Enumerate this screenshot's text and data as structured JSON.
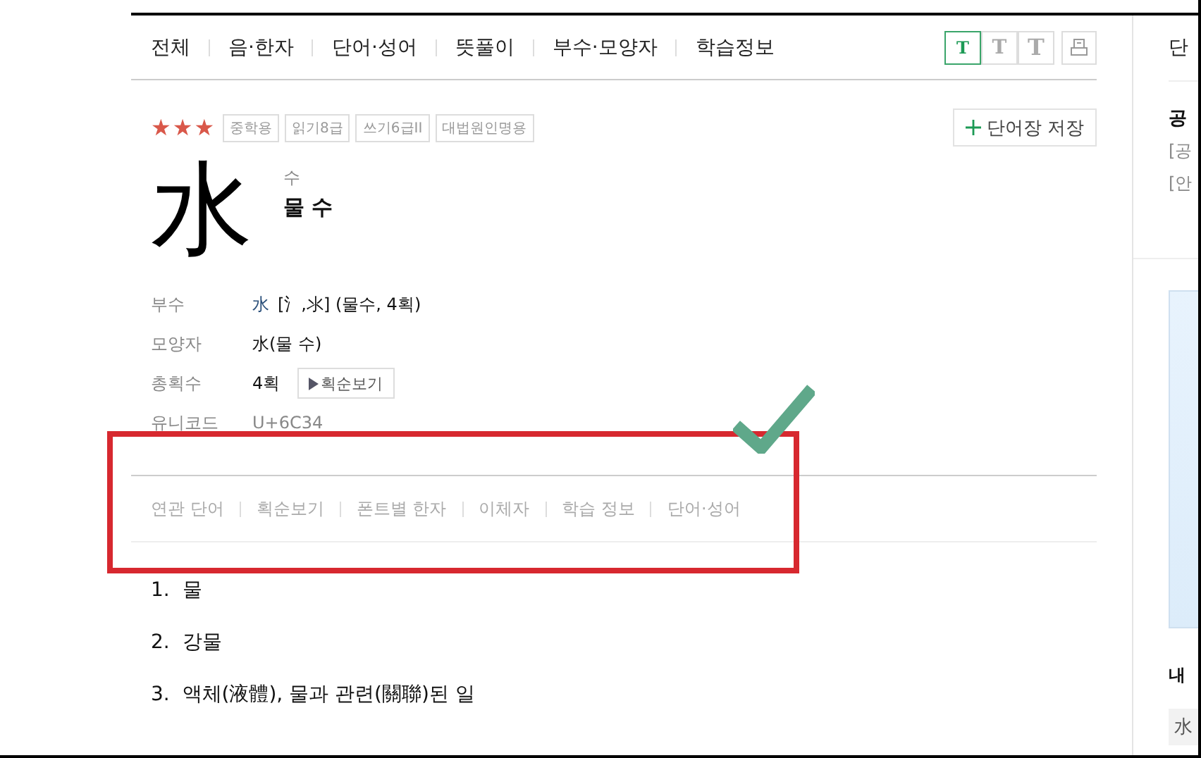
{
  "tabs": [
    {
      "label": "전체",
      "selected": false
    },
    {
      "label": "음·한자",
      "selected": false
    },
    {
      "label": "단어·성어",
      "selected": false
    },
    {
      "label": "뜻풀이",
      "selected": false
    },
    {
      "label": "부수·모양자",
      "selected": false
    },
    {
      "label": "학습정보",
      "selected": false
    }
  ],
  "font_sizes": [
    {
      "label": "T",
      "selected": true
    },
    {
      "label": "T",
      "selected": false
    },
    {
      "label": "T",
      "selected": false
    }
  ],
  "entry": {
    "stars": 3,
    "tags": [
      "중학용",
      "읽기8급",
      "쓰기6급II",
      "대법원인명용"
    ],
    "save_button": "단어장 저장",
    "character": "水",
    "reading": "수",
    "meaning": "물 수",
    "info": [
      {
        "label": "부수",
        "value": "水",
        "value_rest": "[氵,氺] (물수, 4획)"
      },
      {
        "label": "모양자",
        "value": "水(물 수)"
      },
      {
        "label": "총획수",
        "value": "4획",
        "button": "획순보기"
      },
      {
        "label": "유니코드",
        "value": "U+6C34"
      }
    ]
  },
  "subnav": [
    "연관 단어",
    "획순보기",
    "폰트별 한자",
    "이체자",
    "학습 정보",
    "단어·성어"
  ],
  "definitions": [
    "1.  물",
    "2.  강물",
    "3.  액체(液體), 물과 관련(關聯)된 일"
  ],
  "sidebar": {
    "tab": "단",
    "heading": "공",
    "lines": [
      "[공",
      "[안"
    ],
    "heading_2": "내",
    "chip": "水"
  }
}
